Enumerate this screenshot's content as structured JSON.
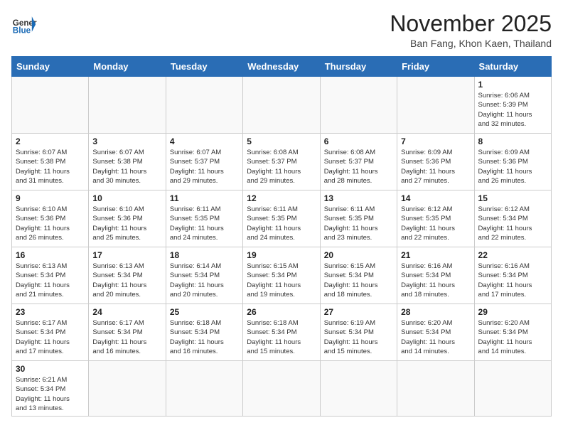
{
  "header": {
    "logo_general": "General",
    "logo_blue": "Blue",
    "month_title": "November 2025",
    "location": "Ban Fang, Khon Kaen, Thailand"
  },
  "weekdays": [
    "Sunday",
    "Monday",
    "Tuesday",
    "Wednesday",
    "Thursday",
    "Friday",
    "Saturday"
  ],
  "weeks": [
    [
      {
        "day": "",
        "info": ""
      },
      {
        "day": "",
        "info": ""
      },
      {
        "day": "",
        "info": ""
      },
      {
        "day": "",
        "info": ""
      },
      {
        "day": "",
        "info": ""
      },
      {
        "day": "",
        "info": ""
      },
      {
        "day": "1",
        "info": "Sunrise: 6:06 AM\nSunset: 5:39 PM\nDaylight: 11 hours\nand 32 minutes."
      }
    ],
    [
      {
        "day": "2",
        "info": "Sunrise: 6:07 AM\nSunset: 5:38 PM\nDaylight: 11 hours\nand 31 minutes."
      },
      {
        "day": "3",
        "info": "Sunrise: 6:07 AM\nSunset: 5:38 PM\nDaylight: 11 hours\nand 30 minutes."
      },
      {
        "day": "4",
        "info": "Sunrise: 6:07 AM\nSunset: 5:37 PM\nDaylight: 11 hours\nand 29 minutes."
      },
      {
        "day": "5",
        "info": "Sunrise: 6:08 AM\nSunset: 5:37 PM\nDaylight: 11 hours\nand 29 minutes."
      },
      {
        "day": "6",
        "info": "Sunrise: 6:08 AM\nSunset: 5:37 PM\nDaylight: 11 hours\nand 28 minutes."
      },
      {
        "day": "7",
        "info": "Sunrise: 6:09 AM\nSunset: 5:36 PM\nDaylight: 11 hours\nand 27 minutes."
      },
      {
        "day": "8",
        "info": "Sunrise: 6:09 AM\nSunset: 5:36 PM\nDaylight: 11 hours\nand 26 minutes."
      }
    ],
    [
      {
        "day": "9",
        "info": "Sunrise: 6:10 AM\nSunset: 5:36 PM\nDaylight: 11 hours\nand 26 minutes."
      },
      {
        "day": "10",
        "info": "Sunrise: 6:10 AM\nSunset: 5:36 PM\nDaylight: 11 hours\nand 25 minutes."
      },
      {
        "day": "11",
        "info": "Sunrise: 6:11 AM\nSunset: 5:35 PM\nDaylight: 11 hours\nand 24 minutes."
      },
      {
        "day": "12",
        "info": "Sunrise: 6:11 AM\nSunset: 5:35 PM\nDaylight: 11 hours\nand 24 minutes."
      },
      {
        "day": "13",
        "info": "Sunrise: 6:11 AM\nSunset: 5:35 PM\nDaylight: 11 hours\nand 23 minutes."
      },
      {
        "day": "14",
        "info": "Sunrise: 6:12 AM\nSunset: 5:35 PM\nDaylight: 11 hours\nand 22 minutes."
      },
      {
        "day": "15",
        "info": "Sunrise: 6:12 AM\nSunset: 5:34 PM\nDaylight: 11 hours\nand 22 minutes."
      }
    ],
    [
      {
        "day": "16",
        "info": "Sunrise: 6:13 AM\nSunset: 5:34 PM\nDaylight: 11 hours\nand 21 minutes."
      },
      {
        "day": "17",
        "info": "Sunrise: 6:13 AM\nSunset: 5:34 PM\nDaylight: 11 hours\nand 20 minutes."
      },
      {
        "day": "18",
        "info": "Sunrise: 6:14 AM\nSunset: 5:34 PM\nDaylight: 11 hours\nand 20 minutes."
      },
      {
        "day": "19",
        "info": "Sunrise: 6:15 AM\nSunset: 5:34 PM\nDaylight: 11 hours\nand 19 minutes."
      },
      {
        "day": "20",
        "info": "Sunrise: 6:15 AM\nSunset: 5:34 PM\nDaylight: 11 hours\nand 18 minutes."
      },
      {
        "day": "21",
        "info": "Sunrise: 6:16 AM\nSunset: 5:34 PM\nDaylight: 11 hours\nand 18 minutes."
      },
      {
        "day": "22",
        "info": "Sunrise: 6:16 AM\nSunset: 5:34 PM\nDaylight: 11 hours\nand 17 minutes."
      }
    ],
    [
      {
        "day": "23",
        "info": "Sunrise: 6:17 AM\nSunset: 5:34 PM\nDaylight: 11 hours\nand 17 minutes."
      },
      {
        "day": "24",
        "info": "Sunrise: 6:17 AM\nSunset: 5:34 PM\nDaylight: 11 hours\nand 16 minutes."
      },
      {
        "day": "25",
        "info": "Sunrise: 6:18 AM\nSunset: 5:34 PM\nDaylight: 11 hours\nand 16 minutes."
      },
      {
        "day": "26",
        "info": "Sunrise: 6:18 AM\nSunset: 5:34 PM\nDaylight: 11 hours\nand 15 minutes."
      },
      {
        "day": "27",
        "info": "Sunrise: 6:19 AM\nSunset: 5:34 PM\nDaylight: 11 hours\nand 15 minutes."
      },
      {
        "day": "28",
        "info": "Sunrise: 6:20 AM\nSunset: 5:34 PM\nDaylight: 11 hours\nand 14 minutes."
      },
      {
        "day": "29",
        "info": "Sunrise: 6:20 AM\nSunset: 5:34 PM\nDaylight: 11 hours\nand 14 minutes."
      }
    ],
    [
      {
        "day": "30",
        "info": "Sunrise: 6:21 AM\nSunset: 5:34 PM\nDaylight: 11 hours\nand 13 minutes."
      },
      {
        "day": "",
        "info": ""
      },
      {
        "day": "",
        "info": ""
      },
      {
        "day": "",
        "info": ""
      },
      {
        "day": "",
        "info": ""
      },
      {
        "day": "",
        "info": ""
      },
      {
        "day": "",
        "info": ""
      }
    ]
  ]
}
